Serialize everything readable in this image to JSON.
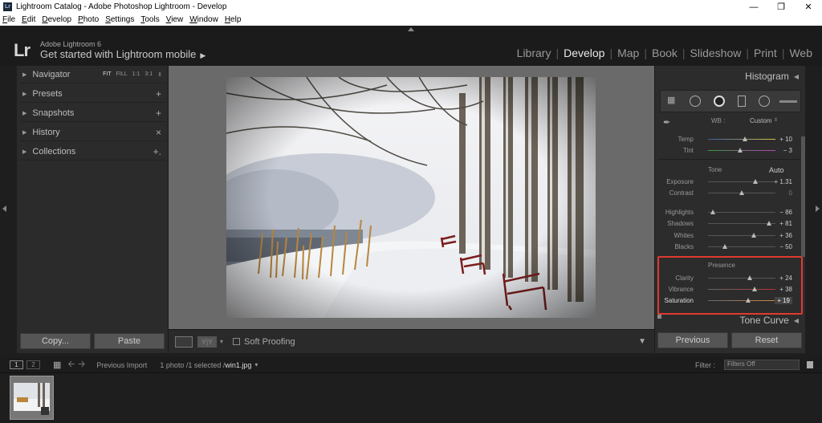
{
  "window": {
    "title": "Lightroom Catalog - Adobe Photoshop Lightroom - Develop",
    "app_icon": "Lr"
  },
  "menu": [
    "File",
    "Edit",
    "Develop",
    "Photo",
    "Settings",
    "Tools",
    "View",
    "Window",
    "Help"
  ],
  "identity": {
    "logo": "Lr",
    "product": "Adobe Lightroom 6",
    "tagline": "Get started with Lightroom mobile"
  },
  "modules": [
    "Library",
    "Develop",
    "Map",
    "Book",
    "Slideshow",
    "Print",
    "Web"
  ],
  "active_module": "Develop",
  "left_panel": {
    "navigator": {
      "label": "Navigator",
      "zoom": {
        "fit": "FIT",
        "fill": "FILL",
        "one": "1:1",
        "three": "3:1"
      }
    },
    "items": [
      {
        "label": "Presets",
        "action": "+"
      },
      {
        "label": "Snapshots",
        "action": "+"
      },
      {
        "label": "History",
        "action": "×"
      },
      {
        "label": "Collections",
        "action": "+."
      }
    ],
    "copy_label": "Copy...",
    "paste_label": "Paste"
  },
  "toolbar": {
    "yy": "Y|Y",
    "soft_proofing": "Soft Proofing"
  },
  "right_panel": {
    "histogram": "Histogram",
    "wb_label": "WB :",
    "wb_value": "Custom",
    "temp": {
      "label": "Temp",
      "value": "+ 10",
      "pos": 0.55
    },
    "tint": {
      "label": "Tint",
      "value": "− 3",
      "pos": 0.48
    },
    "tone_title": "Tone",
    "auto": "Auto",
    "exposure": {
      "label": "Exposure",
      "value": "+ 1.31",
      "pos": 0.7
    },
    "contrast": {
      "label": "Contrast",
      "value": "0",
      "pos": 0.5
    },
    "highlights": {
      "label": "Highlights",
      "value": "− 86",
      "pos": 0.07
    },
    "shadows": {
      "label": "Shadows",
      "value": "+ 81",
      "pos": 0.9
    },
    "whites": {
      "label": "Whites",
      "value": "+ 36",
      "pos": 0.68
    },
    "blacks": {
      "label": "Blacks",
      "value": "− 50",
      "pos": 0.25
    },
    "presence_title": "Presence",
    "clarity": {
      "label": "Clarity",
      "value": "+ 24",
      "pos": 0.62
    },
    "vibrance": {
      "label": "Vibrance",
      "value": "+ 38",
      "pos": 0.69
    },
    "saturation": {
      "label": "Saturation",
      "value": "+ 19",
      "pos": 0.6
    },
    "tone_curve": "Tone Curve",
    "previous": "Previous",
    "reset": "Reset"
  },
  "filmstrip": {
    "page1": "1",
    "page2": "2",
    "source": "Previous Import",
    "count": "1 photo /1 selected /",
    "filename": "win1.jpg",
    "filter_label": "Filter :",
    "filter_value": "Filters Off"
  },
  "colors": {
    "highlight_box": "#e03a2f",
    "panel_bg": "#2c2c2c",
    "canvas_bg": "#6a6a6a"
  }
}
